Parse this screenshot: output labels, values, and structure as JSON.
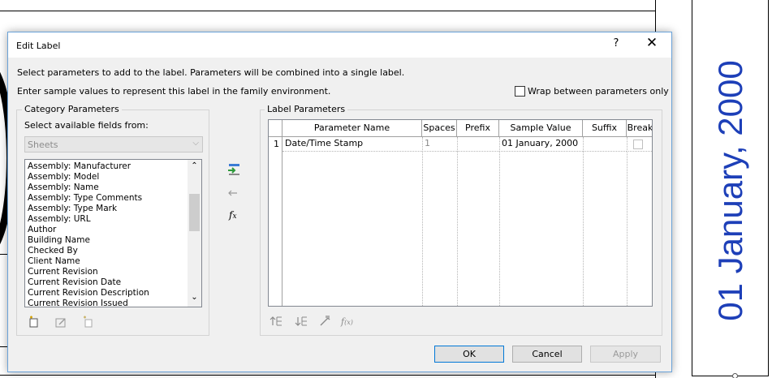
{
  "background": {
    "date_text": "01 January, 2000"
  },
  "dialog": {
    "title": "Edit Label",
    "help_label": "?",
    "close_label": "✕",
    "instruction1": "Select parameters to add to the label.  Parameters will be combined into a single label.",
    "instruction2": "Enter sample values to represent this label in the family environment.",
    "wrap_label": "Wrap between parameters only",
    "wrap_checked": false,
    "category": {
      "title": "Category Parameters",
      "fields_label": "Select available fields from:",
      "select_value": "Sheets",
      "items": [
        "Assembly: Manufacturer",
        "Assembly: Model",
        "Assembly: Name",
        "Assembly: Type Comments",
        "Assembly: Type Mark",
        "Assembly: URL",
        "Author",
        "Building Name",
        "Checked By",
        "Client Name",
        "Current Revision",
        "Current Revision Date",
        "Current Revision Description",
        "Current Revision Issued"
      ]
    },
    "label_params": {
      "title": "Label Parameters",
      "columns": [
        "Parameter Name",
        "Spaces",
        "Prefix",
        "Sample Value",
        "Suffix",
        "Break"
      ],
      "rows": [
        {
          "num": "1",
          "name": "Date/Time Stamp",
          "spaces": "1",
          "prefix": "",
          "sample": "01 January, 2000",
          "suffix": "",
          "break": false
        }
      ]
    },
    "buttons": {
      "ok": "OK",
      "cancel": "Cancel",
      "apply": "Apply"
    }
  }
}
